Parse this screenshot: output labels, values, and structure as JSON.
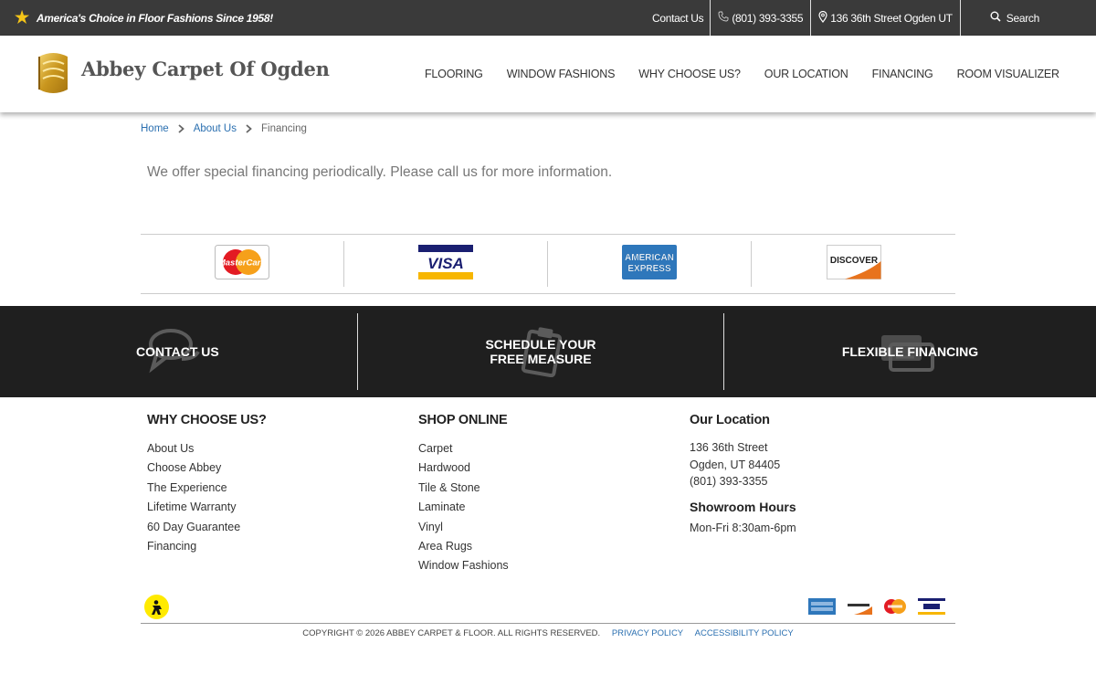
{
  "topbar": {
    "tagline": "America's Choice in Floor Fashions Since 1958!",
    "contact": "Contact Us",
    "phone": "(801) 393-3355",
    "address": "136 36th Street Ogden UT",
    "search": "Search"
  },
  "header": {
    "brand": "Abbey Carpet Of Ogden",
    "nav": [
      "FLOORING",
      "WINDOW FASHIONS",
      "WHY CHOOSE US?",
      "OUR LOCATION",
      "FINANCING",
      "ROOM VISUALIZER"
    ]
  },
  "breadcrumb": {
    "home": "Home",
    "about": "About Us",
    "current": "Financing"
  },
  "intro": "We offer special financing periodically. Please call us for more information.",
  "cards": {
    "mastercard": "MasterCard",
    "visa": "VISA",
    "amex_line1": "AMERICAN",
    "amex_line2": "EXPRESS",
    "discover": "DISCOVER"
  },
  "band": {
    "contact": "CONTACT US",
    "schedule_line1": "SCHEDULE YOUR",
    "schedule_line2": "FREE MEASURE",
    "financing": "FLEXIBLE FINANCING"
  },
  "footer": {
    "why": {
      "title": "WHY CHOOSE US?",
      "items": [
        "About Us",
        "Choose Abbey",
        "The Experience",
        "Lifetime Warranty",
        "60 Day Guarantee",
        "Financing"
      ]
    },
    "shop": {
      "title": "SHOP ONLINE",
      "items": [
        "Carpet",
        "Hardwood",
        "Tile & Stone",
        "Laminate",
        "Vinyl",
        "Area Rugs",
        "Window Fashions"
      ]
    },
    "location": {
      "title": "Our Location",
      "street": "136 36th Street",
      "city": "Ogden, UT 84405",
      "phone": "(801) 393-3355",
      "hours_title": "Showroom Hours",
      "hours": "Mon-Fri 8:30am-6pm"
    }
  },
  "bottom": {
    "copyright": "COPYRIGHT © 2026 ABBEY CARPET & FLOOR. ALL RIGHTS RESERVED.",
    "privacy": "PRIVACY POLICY",
    "accessibility": "ACCESSIBILITY POLICY"
  },
  "colors": {
    "topbar_bg": "#3a3a3a",
    "band_bg": "#1f1f1f",
    "link_blue": "#2a6fb0",
    "star_gold": "#f5c518"
  },
  "icons": [
    "star-icon",
    "phone-icon",
    "map-pin-icon",
    "search-icon",
    "chevron-right-icon",
    "chat-bubbles-icon",
    "clipboard-icon",
    "cards-icon",
    "yellow-pages-icon"
  ]
}
